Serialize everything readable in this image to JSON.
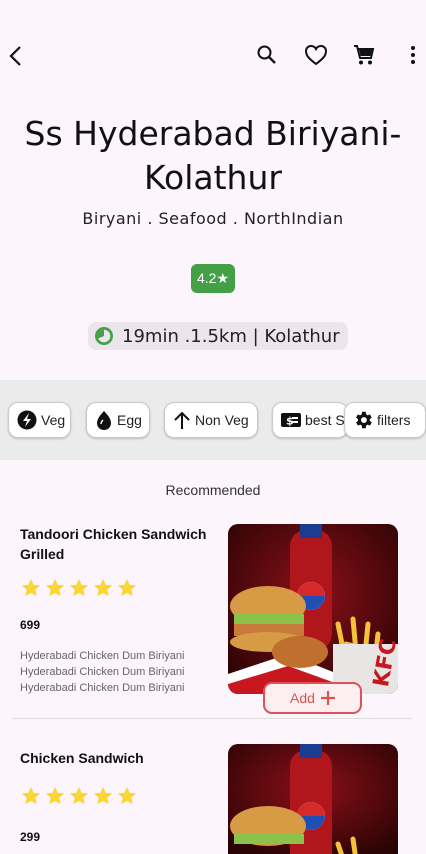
{
  "restaurant": {
    "name": "Ss Hyderabad Biriyani-Kolathur",
    "cuisines": "Biryani . Seafood . NorthIndian",
    "rating": "4.2★",
    "delivery_info": "19min .1.5km | Kolathur"
  },
  "filters": [
    {
      "label": "Veg",
      "icon": "veg-leaf-icon"
    },
    {
      "label": "Egg",
      "icon": "egg-icon"
    },
    {
      "label": "Non Veg",
      "icon": "arrow-up-icon"
    },
    {
      "label": "best Seller",
      "icon": "price-tag-icon"
    },
    {
      "label": "filters",
      "icon": "gear-icon"
    }
  ],
  "section_title": "Recommended",
  "items": [
    {
      "name": "Tandoori Chicken Sandwich Grilled",
      "rating_stars": 5,
      "price": "699",
      "description": "Hyderabadi Chicken Dum Biriyani Hyderabadi Chicken Dum Biriyani Hyderabadi Chicken Dum Biriyani",
      "add_label": "Add"
    },
    {
      "name": "Chicken Sandwich",
      "rating_stars": 5,
      "price": "299"
    }
  ],
  "colors": {
    "background": "#fcf5fc",
    "rating_badge": "#43a047",
    "star": "#fbd634",
    "add_border": "#e0505a"
  }
}
